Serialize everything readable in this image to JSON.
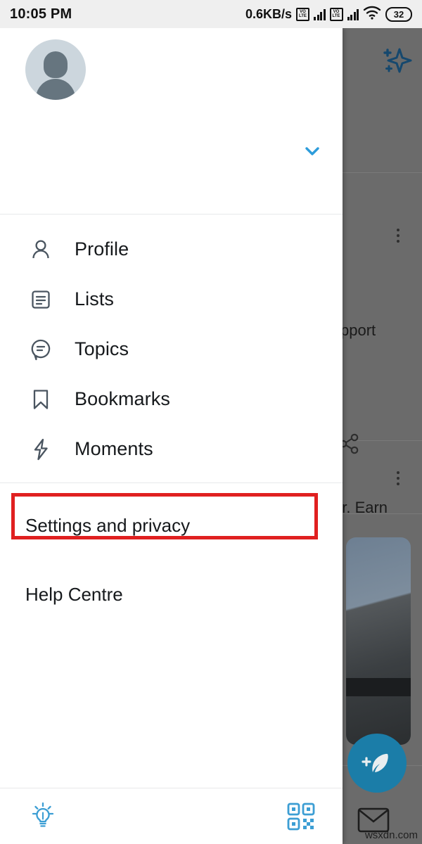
{
  "status_bar": {
    "time": "10:05 PM",
    "network_speed": "0.6KB/s",
    "sim1_badge_top": "VO",
    "sim1_badge_bottom": "LTE",
    "sim2_badge_top": "VO",
    "sim2_badge_bottom": "LTE",
    "battery_level": "32",
    "wifi_icon": "wifi-icon",
    "signal_icon": "signal-bars-icon"
  },
  "drawer": {
    "avatar_icon": "avatar-placeholder-icon",
    "account_expand_icon": "chevron-down-icon",
    "nav_items": [
      {
        "label": "Profile",
        "icon": "person-icon"
      },
      {
        "label": "Lists",
        "icon": "list-icon"
      },
      {
        "label": "Topics",
        "icon": "speech-bubble-icon"
      },
      {
        "label": "Bookmarks",
        "icon": "bookmark-icon"
      },
      {
        "label": "Moments",
        "icon": "lightning-bolt-icon"
      }
    ],
    "secondary_items": [
      {
        "label": "Settings and privacy",
        "highlighted": true
      },
      {
        "label": "Help Centre",
        "highlighted": false
      }
    ],
    "footer": {
      "left_icon": "lightbulb-icon",
      "right_icon": "qr-code-icon"
    }
  },
  "backdrop": {
    "text_support": "pport",
    "text_earn": "er. Earn",
    "sparkle_icon": "sparkle-icon",
    "share_icon": "share-icon",
    "overflow_icon": "more-vertical-icon",
    "compose_icon": "compose-feather-icon",
    "mail_icon": "envelope-icon",
    "photo_alt": "building-photo-thumbnail"
  },
  "watermark": {
    "text": "wsxdn.com"
  },
  "colors": {
    "accent_blue": "#1d9bf0",
    "highlight_red": "#e02020",
    "icon_gray": "#4a5560",
    "status_bg": "#efefef",
    "scrim": "#6b6b6b",
    "fab_blue": "#1b7da8"
  }
}
